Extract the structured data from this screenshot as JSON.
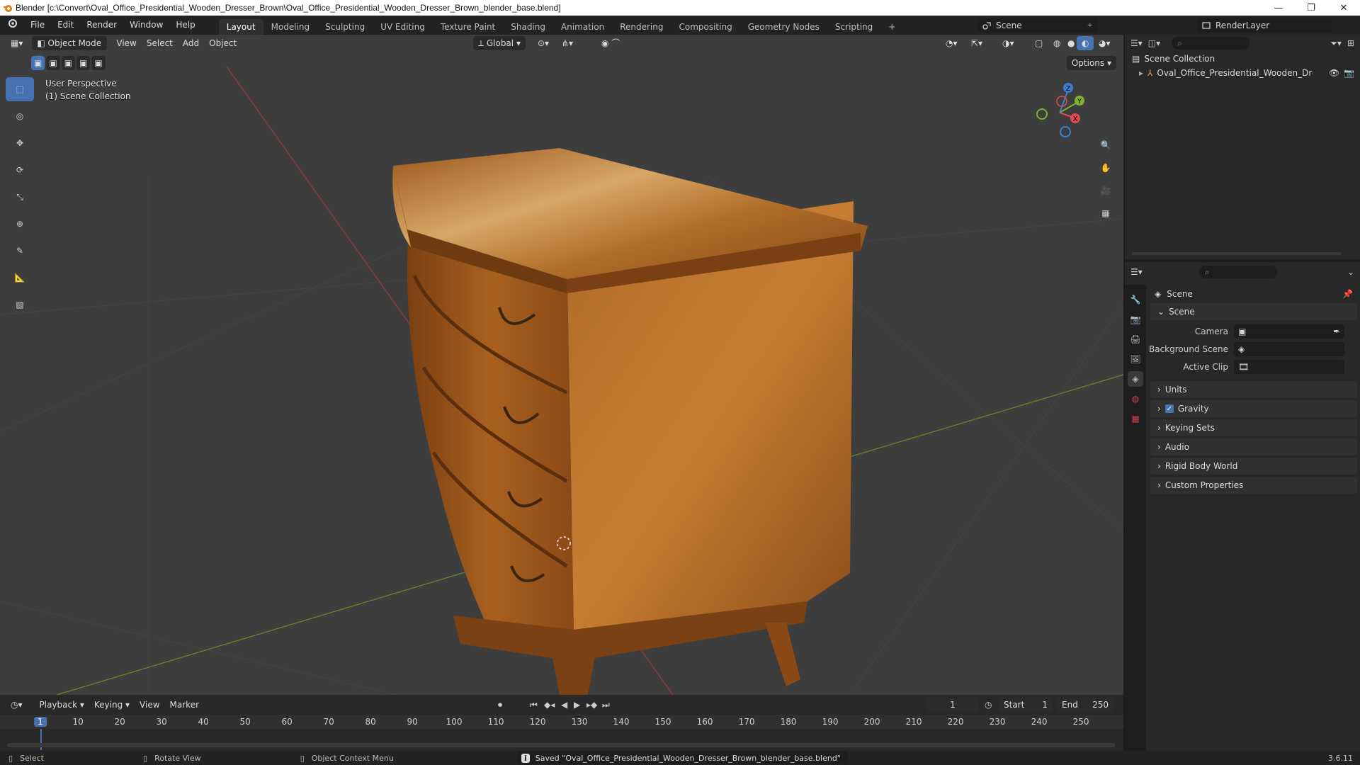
{
  "window": {
    "title": "Blender [c:\\Convert\\Oval_Office_Presidential_Wooden_Dresser_Brown\\Oval_Office_Presidential_Wooden_Dresser_Brown_blender_base.blend]"
  },
  "menu": [
    "File",
    "Edit",
    "Render",
    "Window",
    "Help"
  ],
  "workspaces": [
    "Layout",
    "Modeling",
    "Sculpting",
    "UV Editing",
    "Texture Paint",
    "Shading",
    "Animation",
    "Rendering",
    "Compositing",
    "Geometry Nodes",
    "Scripting"
  ],
  "active_workspace": "Layout",
  "scene_selector": "Scene",
  "view_layer": "RenderLayer",
  "viewport": {
    "mode": "Object Mode",
    "menus": [
      "View",
      "Select",
      "Add",
      "Object"
    ],
    "orientation": "Global",
    "options": "Options",
    "info_line1": "User Perspective",
    "info_line2": "(1) Scene Collection",
    "gizmo_axes": {
      "x": "X",
      "y": "Y",
      "z": "Z"
    }
  },
  "outliner": {
    "root": "Scene Collection",
    "item": "Oval_Office_Presidential_Wooden_Dress"
  },
  "properties": {
    "header": "Scene",
    "panel": "Scene",
    "fields": [
      {
        "label": "Camera"
      },
      {
        "label": "Background Scene"
      },
      {
        "label": "Active Clip"
      }
    ],
    "sections": [
      "Units",
      "Gravity",
      "Keying Sets",
      "Audio",
      "Rigid Body World",
      "Custom Properties"
    ],
    "gravity_checked": true
  },
  "timeline": {
    "menus": [
      "Playback",
      "Keying",
      "View",
      "Marker"
    ],
    "current_frame": "1",
    "start_label": "Start",
    "start": "1",
    "end_label": "End",
    "end": "250",
    "ruler": [
      "1",
      "10",
      "20",
      "30",
      "40",
      "50",
      "60",
      "70",
      "80",
      "90",
      "100",
      "110",
      "120",
      "130",
      "140",
      "150",
      "160",
      "170",
      "180",
      "190",
      "200",
      "210",
      "220",
      "230",
      "240",
      "250"
    ]
  },
  "status": {
    "select": "Select",
    "rotate": "Rotate View",
    "context": "Object Context Menu",
    "message": "Saved \"Oval_Office_Presidential_Wooden_Dresser_Brown_blender_base.blend\"",
    "version": "3.6.11"
  },
  "colors": {
    "accent": "#4772b3",
    "viewport_bg": "#3d3d3d",
    "wood_dark": "#6b3a12",
    "wood_light": "#c1772e"
  }
}
